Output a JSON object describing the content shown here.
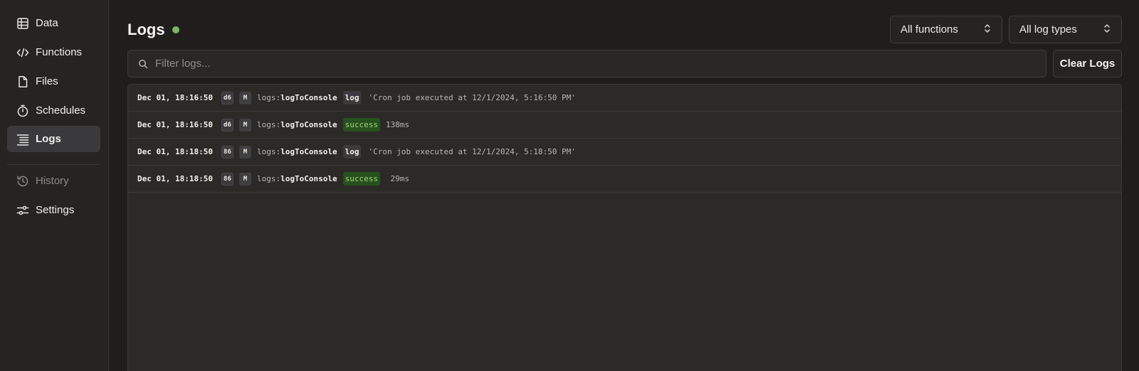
{
  "sidebar": {
    "items": [
      {
        "label": "Data",
        "icon": "table-icon"
      },
      {
        "label": "Functions",
        "icon": "code-icon"
      },
      {
        "label": "Files",
        "icon": "file-icon"
      },
      {
        "label": "Schedules",
        "icon": "stopwatch-icon"
      },
      {
        "label": "Logs",
        "icon": "list-icon",
        "active": true
      },
      {
        "label": "History",
        "icon": "history-icon",
        "muted": true
      },
      {
        "label": "Settings",
        "icon": "sliders-icon"
      }
    ]
  },
  "header": {
    "title": "Logs",
    "status_color": "#7fb26a"
  },
  "filters": {
    "functions_select": "All functions",
    "log_types_select": "All log types"
  },
  "search": {
    "placeholder": "Filter logs..."
  },
  "toolbar": {
    "clear_label": "Clear Logs"
  },
  "logs": [
    {
      "time": "Dec 01, 18:16:50",
      "id": "d6",
      "type": "M",
      "prefix": "logs:",
      "fn": "logToConsole",
      "tag": "log",
      "message": "'Cron job executed at 12/1/2024, 5:16:50 PM'"
    },
    {
      "time": "Dec 01, 18:16:50",
      "id": "d6",
      "type": "M",
      "prefix": "logs:",
      "fn": "logToConsole",
      "tag": "success",
      "message": "138ms"
    },
    {
      "time": "Dec 01, 18:18:50",
      "id": "86",
      "type": "M",
      "prefix": "logs:",
      "fn": "logToConsole",
      "tag": "log",
      "message": "'Cron job executed at 12/1/2024, 5:18:50 PM'"
    },
    {
      "time": "Dec 01, 18:18:50",
      "id": "86",
      "type": "M",
      "prefix": "logs:",
      "fn": "logToConsole",
      "tag": "success",
      "message": " 29ms"
    }
  ]
}
